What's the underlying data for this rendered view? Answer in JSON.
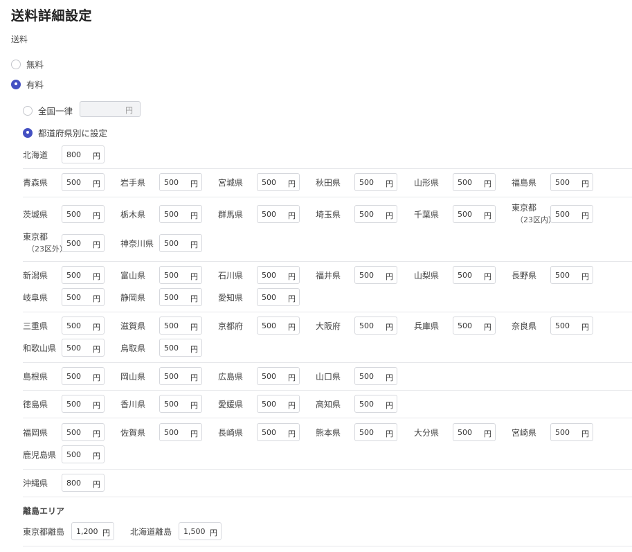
{
  "title": "送料詳細設定",
  "shipping_label": "送料",
  "options": {
    "free": "無料",
    "paid": "有料"
  },
  "paid_options": {
    "flat": "全国一律",
    "by_pref": "都道府県別に設定"
  },
  "flat_rate": {
    "value": "",
    "unit": "円"
  },
  "unit": "円",
  "hokkaido": {
    "name": "北海道",
    "value": "800"
  },
  "tohoku": [
    {
      "name": "青森県",
      "value": "500"
    },
    {
      "name": "岩手県",
      "value": "500"
    },
    {
      "name": "宮城県",
      "value": "500"
    },
    {
      "name": "秋田県",
      "value": "500"
    },
    {
      "name": "山形県",
      "value": "500"
    },
    {
      "name": "福島県",
      "value": "500"
    }
  ],
  "kanto": [
    {
      "name": "茨城県",
      "value": "500"
    },
    {
      "name": "栃木県",
      "value": "500"
    },
    {
      "name": "群馬県",
      "value": "500"
    },
    {
      "name": "埼玉県",
      "value": "500"
    },
    {
      "name": "千葉県",
      "value": "500"
    },
    {
      "name": "東京都",
      "note": "（23区内）",
      "value": "500"
    },
    {
      "name": "東京都",
      "note": "（23区外）",
      "value": "500"
    },
    {
      "name": "神奈川県",
      "value": "500"
    }
  ],
  "chubu": [
    {
      "name": "新潟県",
      "value": "500"
    },
    {
      "name": "富山県",
      "value": "500"
    },
    {
      "name": "石川県",
      "value": "500"
    },
    {
      "name": "福井県",
      "value": "500"
    },
    {
      "name": "山梨県",
      "value": "500"
    },
    {
      "name": "長野県",
      "value": "500"
    },
    {
      "name": "岐阜県",
      "value": "500"
    },
    {
      "name": "静岡県",
      "value": "500"
    },
    {
      "name": "愛知県",
      "value": "500"
    }
  ],
  "kinki": [
    {
      "name": "三重県",
      "value": "500"
    },
    {
      "name": "滋賀県",
      "value": "500"
    },
    {
      "name": "京都府",
      "value": "500"
    },
    {
      "name": "大阪府",
      "value": "500"
    },
    {
      "name": "兵庫県",
      "value": "500"
    },
    {
      "name": "奈良県",
      "value": "500"
    },
    {
      "name": "和歌山県",
      "value": "500"
    },
    {
      "name": "鳥取県",
      "value": "500"
    }
  ],
  "chugoku": [
    {
      "name": "島根県",
      "value": "500"
    },
    {
      "name": "岡山県",
      "value": "500"
    },
    {
      "name": "広島県",
      "value": "500"
    },
    {
      "name": "山口県",
      "value": "500"
    }
  ],
  "shikoku": [
    {
      "name": "徳島県",
      "value": "500"
    },
    {
      "name": "香川県",
      "value": "500"
    },
    {
      "name": "愛媛県",
      "value": "500"
    },
    {
      "name": "高知県",
      "value": "500"
    }
  ],
  "kyushu": [
    {
      "name": "福岡県",
      "value": "500"
    },
    {
      "name": "佐賀県",
      "value": "500"
    },
    {
      "name": "長崎県",
      "value": "500"
    },
    {
      "name": "熊本県",
      "value": "500"
    },
    {
      "name": "大分県",
      "value": "500"
    },
    {
      "name": "宮崎県",
      "value": "500"
    },
    {
      "name": "鹿児島県",
      "value": "500"
    }
  ],
  "okinawa": {
    "name": "沖縄県",
    "value": "800"
  },
  "islands": {
    "heading": "離島エリア",
    "items": [
      {
        "name": "東京都離島",
        "value": "1,200"
      },
      {
        "name": "北海道離島",
        "value": "1,500"
      }
    ]
  },
  "colors": {
    "accent": "#4450c2",
    "border": "#d6d8dd",
    "divider": "#e6e7ea"
  }
}
